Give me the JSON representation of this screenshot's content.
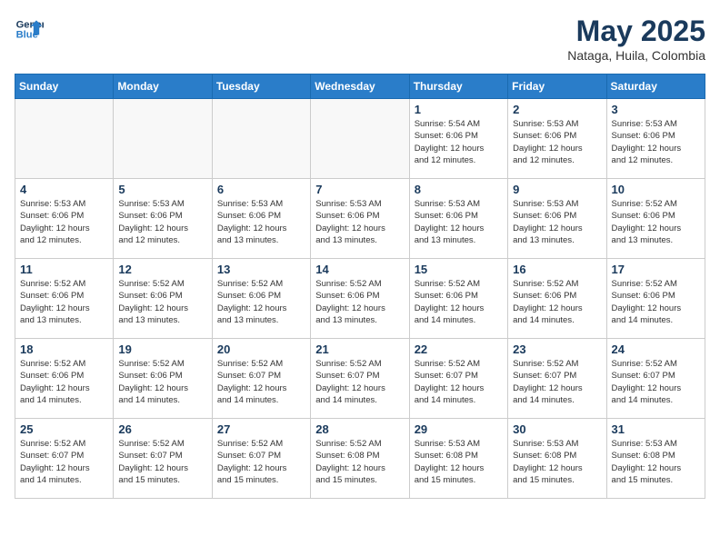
{
  "logo": {
    "line1": "General",
    "line2": "Blue"
  },
  "title": {
    "month_year": "May 2025",
    "location": "Nataga, Huila, Colombia"
  },
  "days_of_week": [
    "Sunday",
    "Monday",
    "Tuesday",
    "Wednesday",
    "Thursday",
    "Friday",
    "Saturday"
  ],
  "weeks": [
    [
      {
        "day": "",
        "info": ""
      },
      {
        "day": "",
        "info": ""
      },
      {
        "day": "",
        "info": ""
      },
      {
        "day": "",
        "info": ""
      },
      {
        "day": "1",
        "info": "Sunrise: 5:54 AM\nSunset: 6:06 PM\nDaylight: 12 hours\nand 12 minutes."
      },
      {
        "day": "2",
        "info": "Sunrise: 5:53 AM\nSunset: 6:06 PM\nDaylight: 12 hours\nand 12 minutes."
      },
      {
        "day": "3",
        "info": "Sunrise: 5:53 AM\nSunset: 6:06 PM\nDaylight: 12 hours\nand 12 minutes."
      }
    ],
    [
      {
        "day": "4",
        "info": "Sunrise: 5:53 AM\nSunset: 6:06 PM\nDaylight: 12 hours\nand 12 minutes."
      },
      {
        "day": "5",
        "info": "Sunrise: 5:53 AM\nSunset: 6:06 PM\nDaylight: 12 hours\nand 12 minutes."
      },
      {
        "day": "6",
        "info": "Sunrise: 5:53 AM\nSunset: 6:06 PM\nDaylight: 12 hours\nand 13 minutes."
      },
      {
        "day": "7",
        "info": "Sunrise: 5:53 AM\nSunset: 6:06 PM\nDaylight: 12 hours\nand 13 minutes."
      },
      {
        "day": "8",
        "info": "Sunrise: 5:53 AM\nSunset: 6:06 PM\nDaylight: 12 hours\nand 13 minutes."
      },
      {
        "day": "9",
        "info": "Sunrise: 5:53 AM\nSunset: 6:06 PM\nDaylight: 12 hours\nand 13 minutes."
      },
      {
        "day": "10",
        "info": "Sunrise: 5:52 AM\nSunset: 6:06 PM\nDaylight: 12 hours\nand 13 minutes."
      }
    ],
    [
      {
        "day": "11",
        "info": "Sunrise: 5:52 AM\nSunset: 6:06 PM\nDaylight: 12 hours\nand 13 minutes."
      },
      {
        "day": "12",
        "info": "Sunrise: 5:52 AM\nSunset: 6:06 PM\nDaylight: 12 hours\nand 13 minutes."
      },
      {
        "day": "13",
        "info": "Sunrise: 5:52 AM\nSunset: 6:06 PM\nDaylight: 12 hours\nand 13 minutes."
      },
      {
        "day": "14",
        "info": "Sunrise: 5:52 AM\nSunset: 6:06 PM\nDaylight: 12 hours\nand 13 minutes."
      },
      {
        "day": "15",
        "info": "Sunrise: 5:52 AM\nSunset: 6:06 PM\nDaylight: 12 hours\nand 14 minutes."
      },
      {
        "day": "16",
        "info": "Sunrise: 5:52 AM\nSunset: 6:06 PM\nDaylight: 12 hours\nand 14 minutes."
      },
      {
        "day": "17",
        "info": "Sunrise: 5:52 AM\nSunset: 6:06 PM\nDaylight: 12 hours\nand 14 minutes."
      }
    ],
    [
      {
        "day": "18",
        "info": "Sunrise: 5:52 AM\nSunset: 6:06 PM\nDaylight: 12 hours\nand 14 minutes."
      },
      {
        "day": "19",
        "info": "Sunrise: 5:52 AM\nSunset: 6:06 PM\nDaylight: 12 hours\nand 14 minutes."
      },
      {
        "day": "20",
        "info": "Sunrise: 5:52 AM\nSunset: 6:07 PM\nDaylight: 12 hours\nand 14 minutes."
      },
      {
        "day": "21",
        "info": "Sunrise: 5:52 AM\nSunset: 6:07 PM\nDaylight: 12 hours\nand 14 minutes."
      },
      {
        "day": "22",
        "info": "Sunrise: 5:52 AM\nSunset: 6:07 PM\nDaylight: 12 hours\nand 14 minutes."
      },
      {
        "day": "23",
        "info": "Sunrise: 5:52 AM\nSunset: 6:07 PM\nDaylight: 12 hours\nand 14 minutes."
      },
      {
        "day": "24",
        "info": "Sunrise: 5:52 AM\nSunset: 6:07 PM\nDaylight: 12 hours\nand 14 minutes."
      }
    ],
    [
      {
        "day": "25",
        "info": "Sunrise: 5:52 AM\nSunset: 6:07 PM\nDaylight: 12 hours\nand 14 minutes."
      },
      {
        "day": "26",
        "info": "Sunrise: 5:52 AM\nSunset: 6:07 PM\nDaylight: 12 hours\nand 15 minutes."
      },
      {
        "day": "27",
        "info": "Sunrise: 5:52 AM\nSunset: 6:07 PM\nDaylight: 12 hours\nand 15 minutes."
      },
      {
        "day": "28",
        "info": "Sunrise: 5:52 AM\nSunset: 6:08 PM\nDaylight: 12 hours\nand 15 minutes."
      },
      {
        "day": "29",
        "info": "Sunrise: 5:53 AM\nSunset: 6:08 PM\nDaylight: 12 hours\nand 15 minutes."
      },
      {
        "day": "30",
        "info": "Sunrise: 5:53 AM\nSunset: 6:08 PM\nDaylight: 12 hours\nand 15 minutes."
      },
      {
        "day": "31",
        "info": "Sunrise: 5:53 AM\nSunset: 6:08 PM\nDaylight: 12 hours\nand 15 minutes."
      }
    ]
  ]
}
